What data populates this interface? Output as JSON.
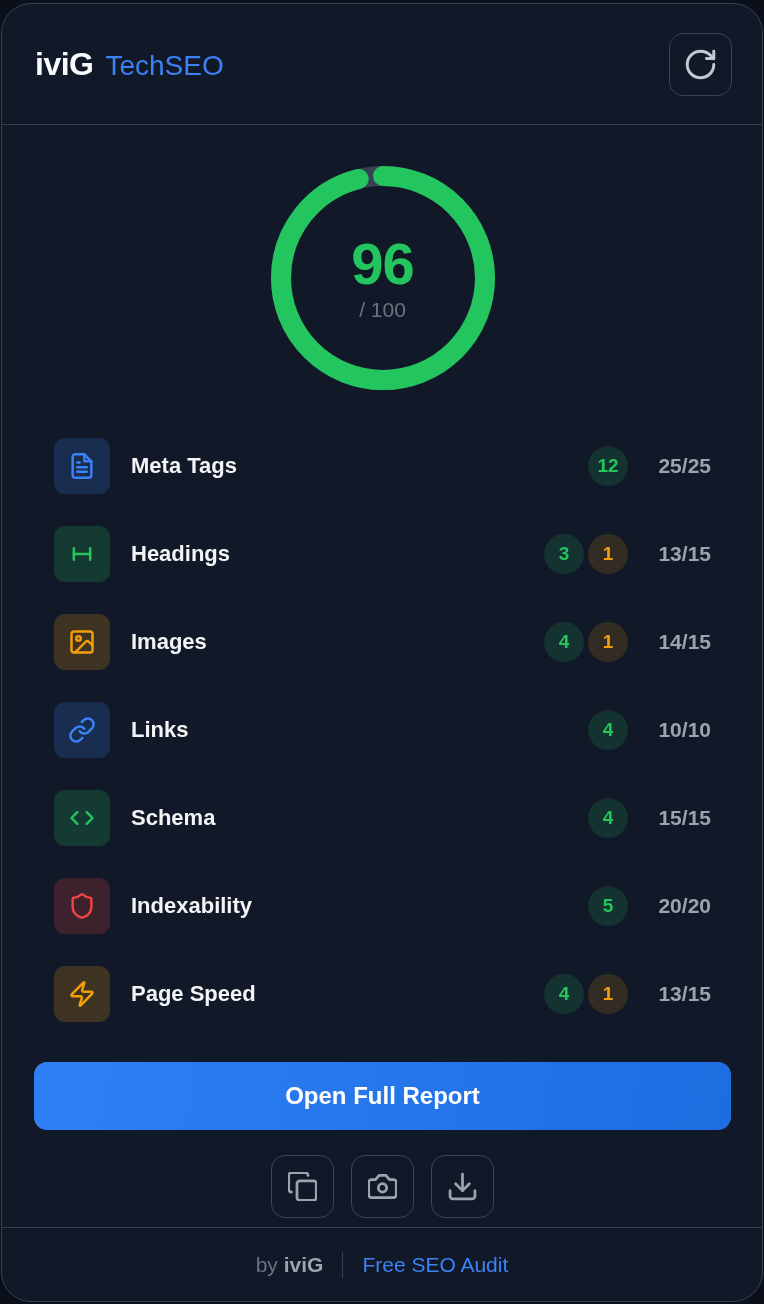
{
  "header": {
    "logo": "iviG",
    "product": "TechSEO"
  },
  "score": {
    "value": "96",
    "max": "/ 100",
    "level": 0.96
  },
  "categories": [
    {
      "name": "Meta Tags",
      "color": "#3b82f6",
      "badges": [
        {
          "kind": "pass",
          "count": "12"
        }
      ],
      "score": "25/25"
    },
    {
      "name": "Headings",
      "color": "#22c55e",
      "badges": [
        {
          "kind": "pass",
          "count": "3"
        },
        {
          "kind": "warn",
          "count": "1"
        }
      ],
      "score": "13/15"
    },
    {
      "name": "Images",
      "color": "#f59e0b",
      "badges": [
        {
          "kind": "pass",
          "count": "4"
        },
        {
          "kind": "warn",
          "count": "1"
        }
      ],
      "score": "14/15"
    },
    {
      "name": "Links",
      "color": "#3b82f6",
      "badges": [
        {
          "kind": "pass",
          "count": "4"
        }
      ],
      "score": "10/10"
    },
    {
      "name": "Schema",
      "color": "#22c55e",
      "badges": [
        {
          "kind": "pass",
          "count": "4"
        }
      ],
      "score": "15/15"
    },
    {
      "name": "Indexability",
      "color": "#ef4444",
      "badges": [
        {
          "kind": "pass",
          "count": "5"
        }
      ],
      "score": "20/20"
    },
    {
      "name": "Page Speed",
      "color": "#f59e0b",
      "badges": [
        {
          "kind": "pass",
          "count": "4"
        },
        {
          "kind": "warn",
          "count": "1"
        }
      ],
      "score": "13/15"
    }
  ],
  "report_button": "Open Full Report",
  "footer": {
    "credit": "by **iviG**",
    "link": "Free SEO Audit"
  }
}
